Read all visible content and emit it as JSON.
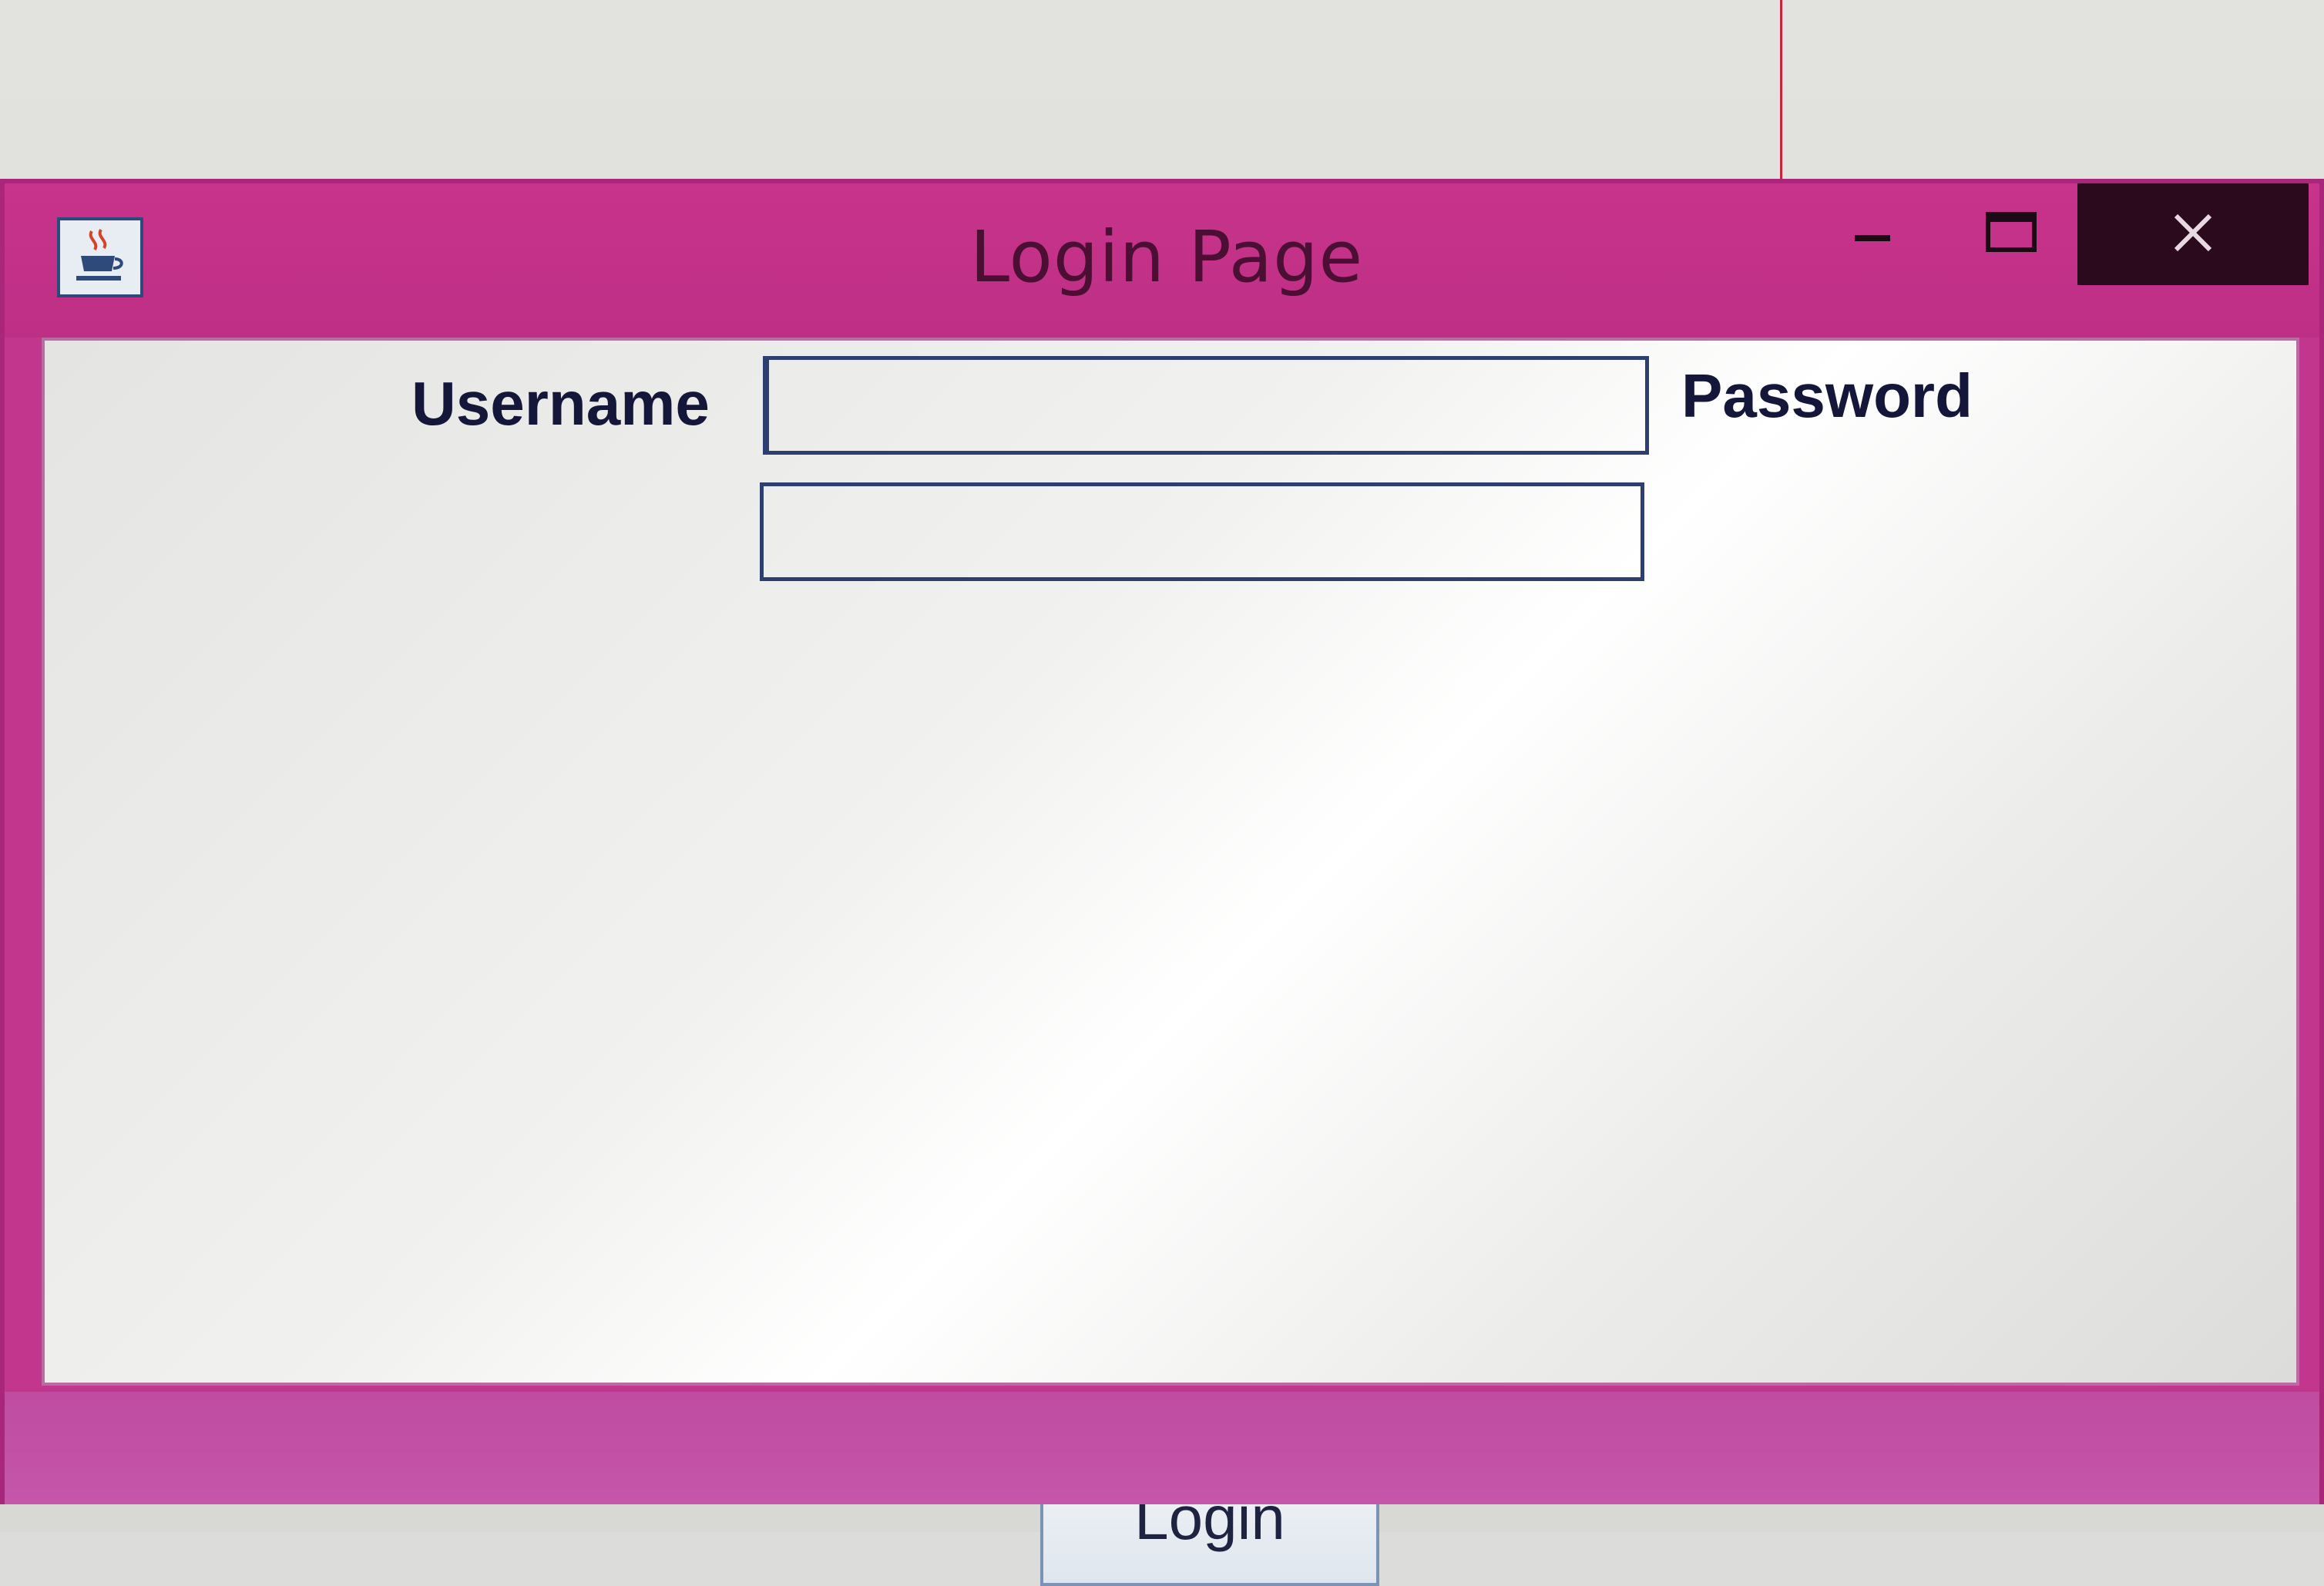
{
  "window": {
    "title": "Login Page",
    "app_icon": "java-coffee-cup-icon",
    "controls": {
      "minimize_icon": "minimize-icon",
      "maximize_icon": "maximize-icon",
      "close_icon": "close-icon"
    },
    "colors": {
      "frame": "#c2368d",
      "title_text": "#4a0f33",
      "close_bg": "#2a0a1c",
      "client_bg": "#f0f0ee"
    }
  },
  "form": {
    "username_label": "Username",
    "username_value": "",
    "password_label": "Password",
    "password_value": "",
    "login_button": "Login"
  }
}
